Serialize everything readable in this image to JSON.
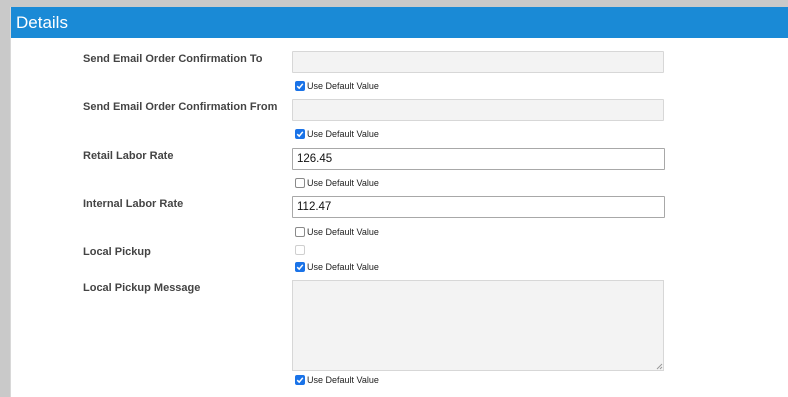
{
  "header": {
    "title": "Details"
  },
  "default_label": "Use Default Value",
  "fields": [
    {
      "label": "Send Email Order Confirmation To",
      "value": "",
      "use_default": true
    },
    {
      "label": "Send Email Order Confirmation From",
      "value": "",
      "use_default": true
    },
    {
      "label": "Retail Labor Rate",
      "value": "126.45",
      "use_default": false
    },
    {
      "label": "Internal Labor Rate",
      "value": "112.47",
      "use_default": false
    },
    {
      "label": "Local Pickup",
      "checked": false,
      "use_default": true
    },
    {
      "label": "Local Pickup Message",
      "value": "",
      "use_default": true
    }
  ],
  "colors": {
    "accent": "#1a8ad6",
    "checkbox": "#1a73e8"
  }
}
